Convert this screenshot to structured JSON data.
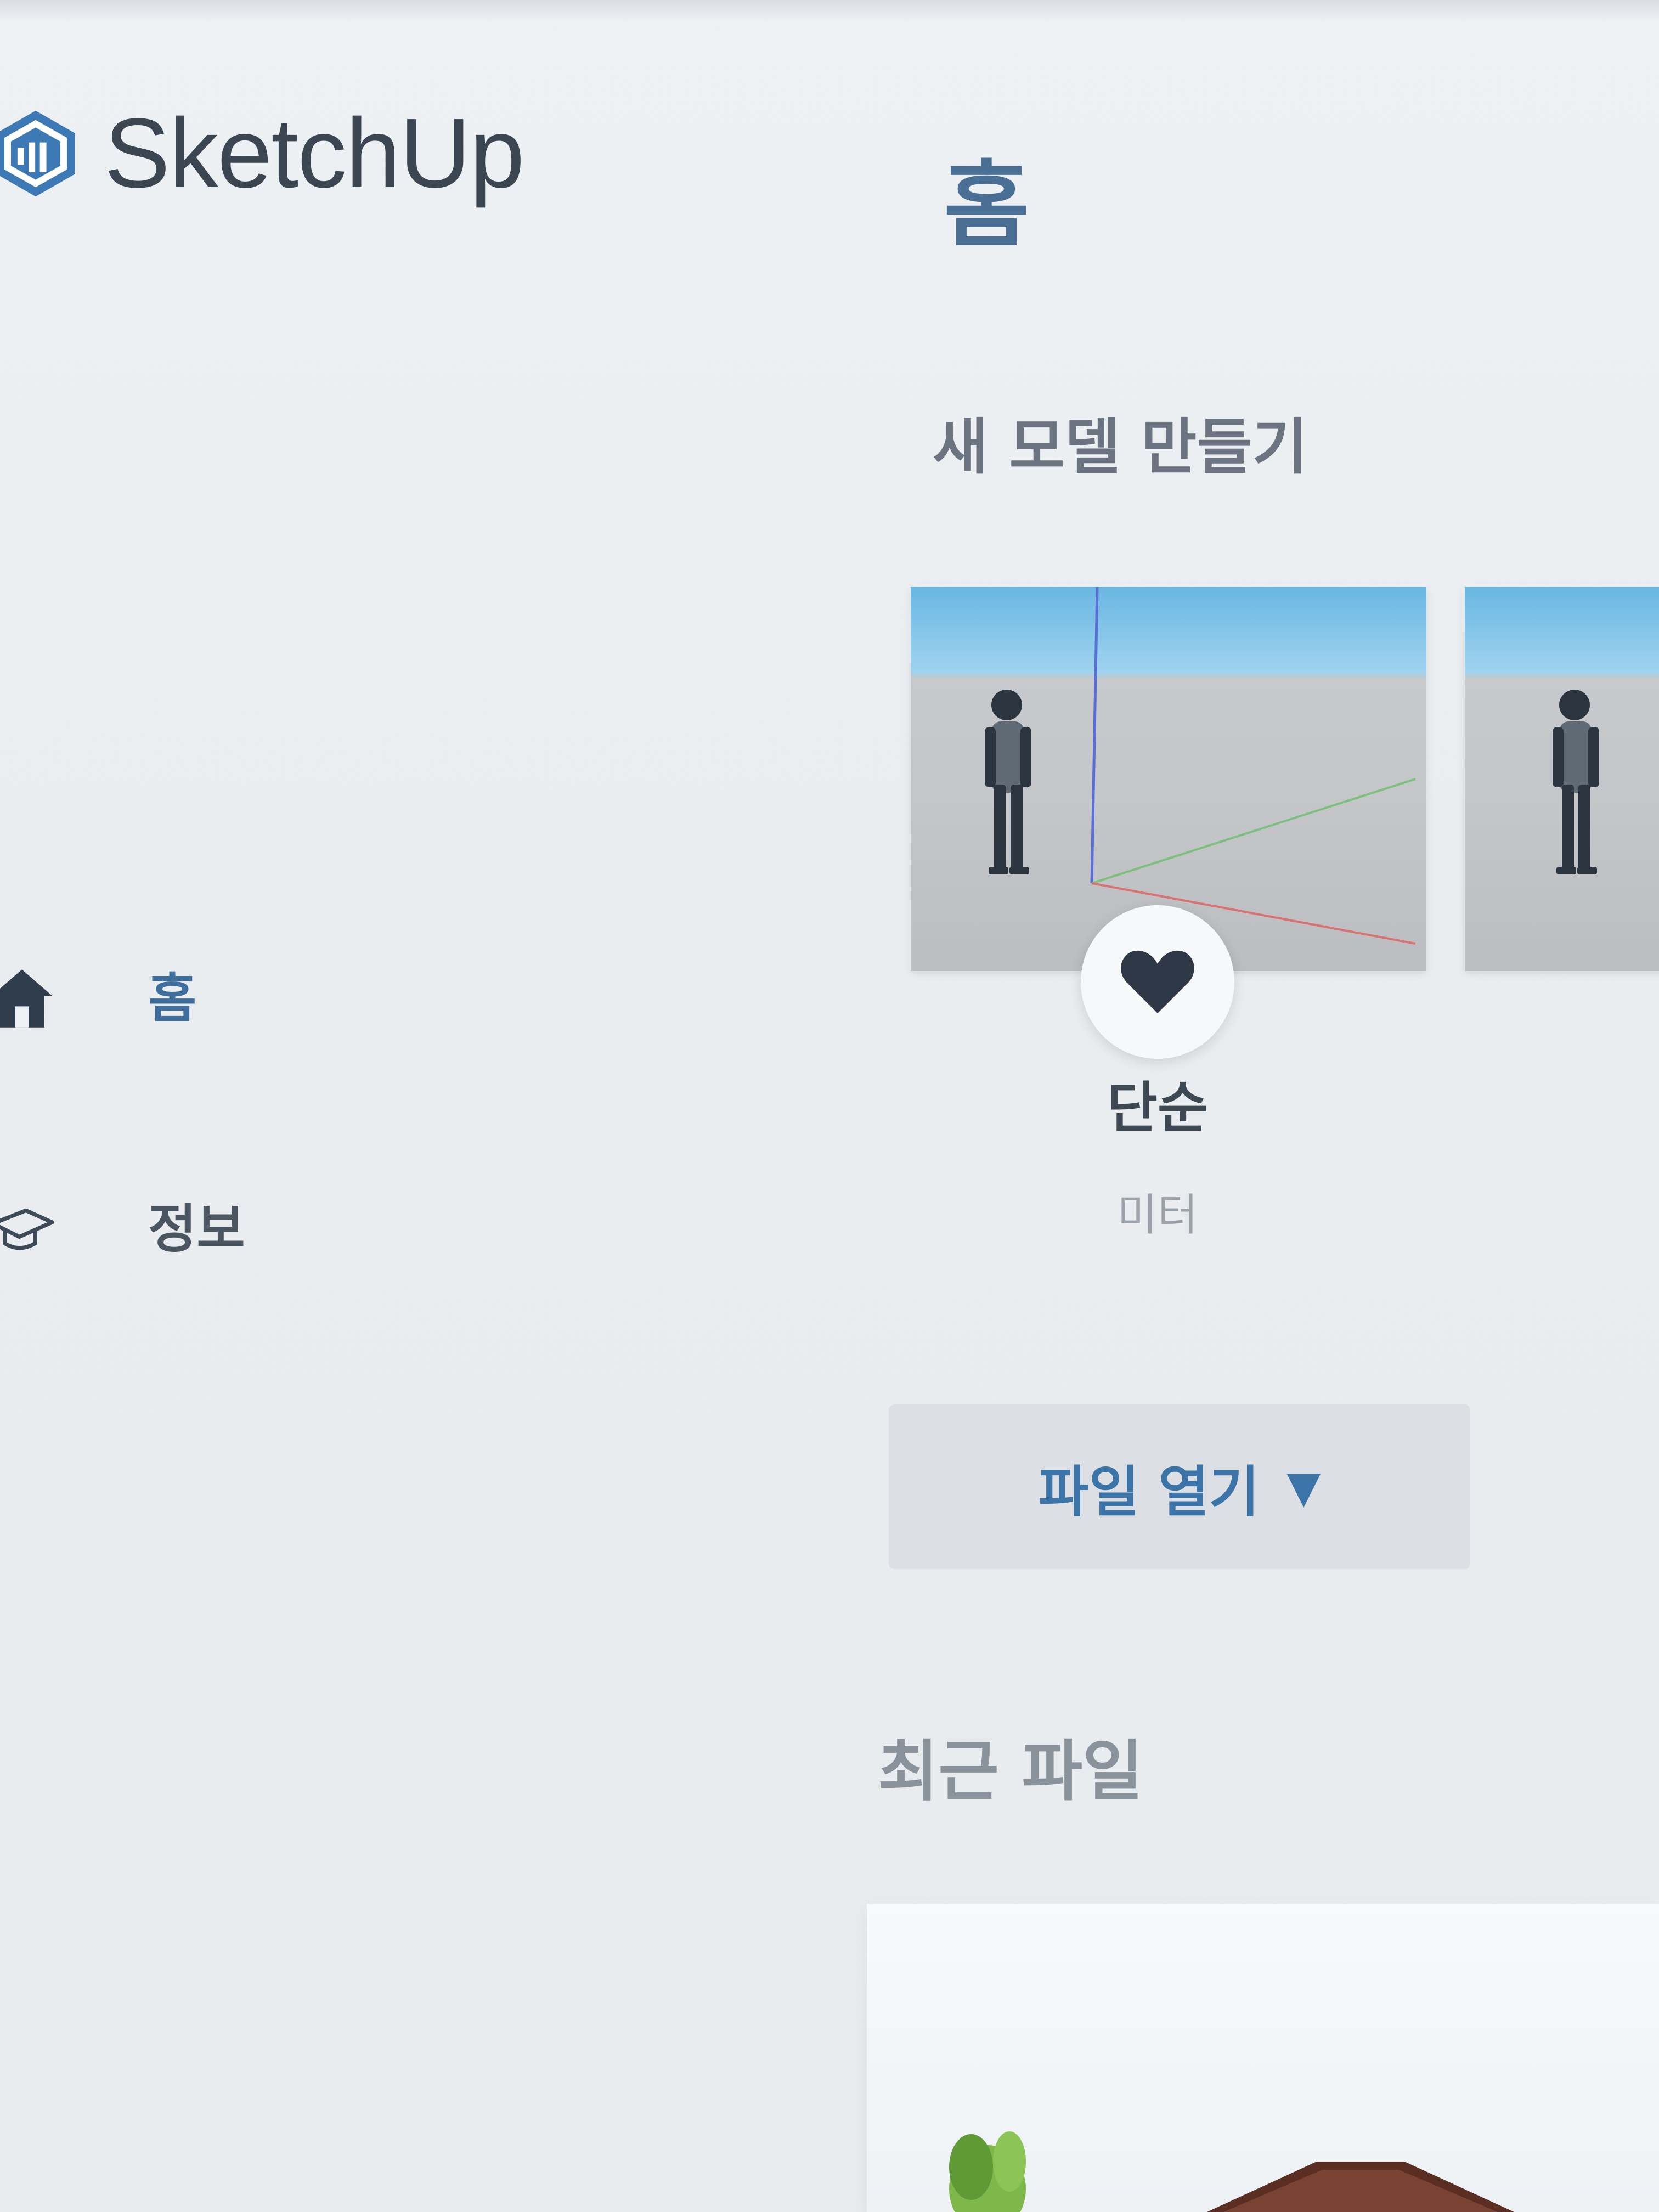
{
  "app": {
    "brand_name": "SketchUp",
    "accent_color": "#3f6e9c"
  },
  "sidebar": {
    "items": [
      {
        "label": "홈",
        "icon": "house-icon",
        "active": true
      },
      {
        "label": "정보",
        "icon": "graduation-cap-icon",
        "active": false
      }
    ]
  },
  "main": {
    "title": "홈",
    "new_model_heading": "새 모델 만들기",
    "templates": [
      {
        "name": "단순",
        "unit": "미터",
        "favorite": true
      },
      {
        "name": "",
        "unit": "",
        "favorite": false
      }
    ],
    "open_file_label": "파일 열기",
    "open_file_caret": "▼",
    "recent_heading": "최근 파일"
  }
}
